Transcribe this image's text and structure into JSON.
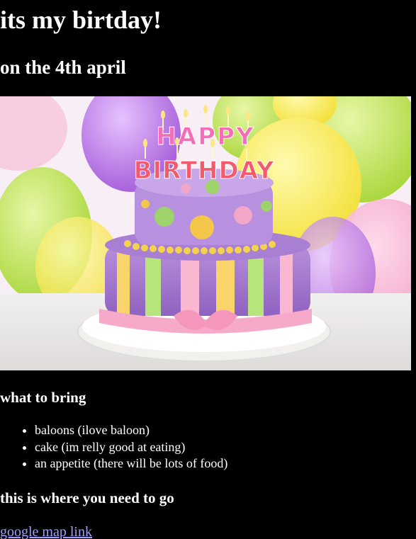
{
  "page": {
    "title": "its my birtday!",
    "subtitle": "on the 4th april"
  },
  "hero_image": {
    "icon": "birthday-cake-photo",
    "cake_text_top": "HAPPY",
    "cake_text_bottom": "BIRTHDAY"
  },
  "bring_section": {
    "heading": "what to bring",
    "items": [
      "baloons (ilove baloon)",
      "cake (im relly good at eating)",
      "an appetite (there will be lots of food)"
    ]
  },
  "directions_section": {
    "heading": "this is where you need to go",
    "link_label": "google map link"
  },
  "colors": {
    "background": "#000000",
    "text": "#ffffff",
    "link": "#9e9eff"
  }
}
